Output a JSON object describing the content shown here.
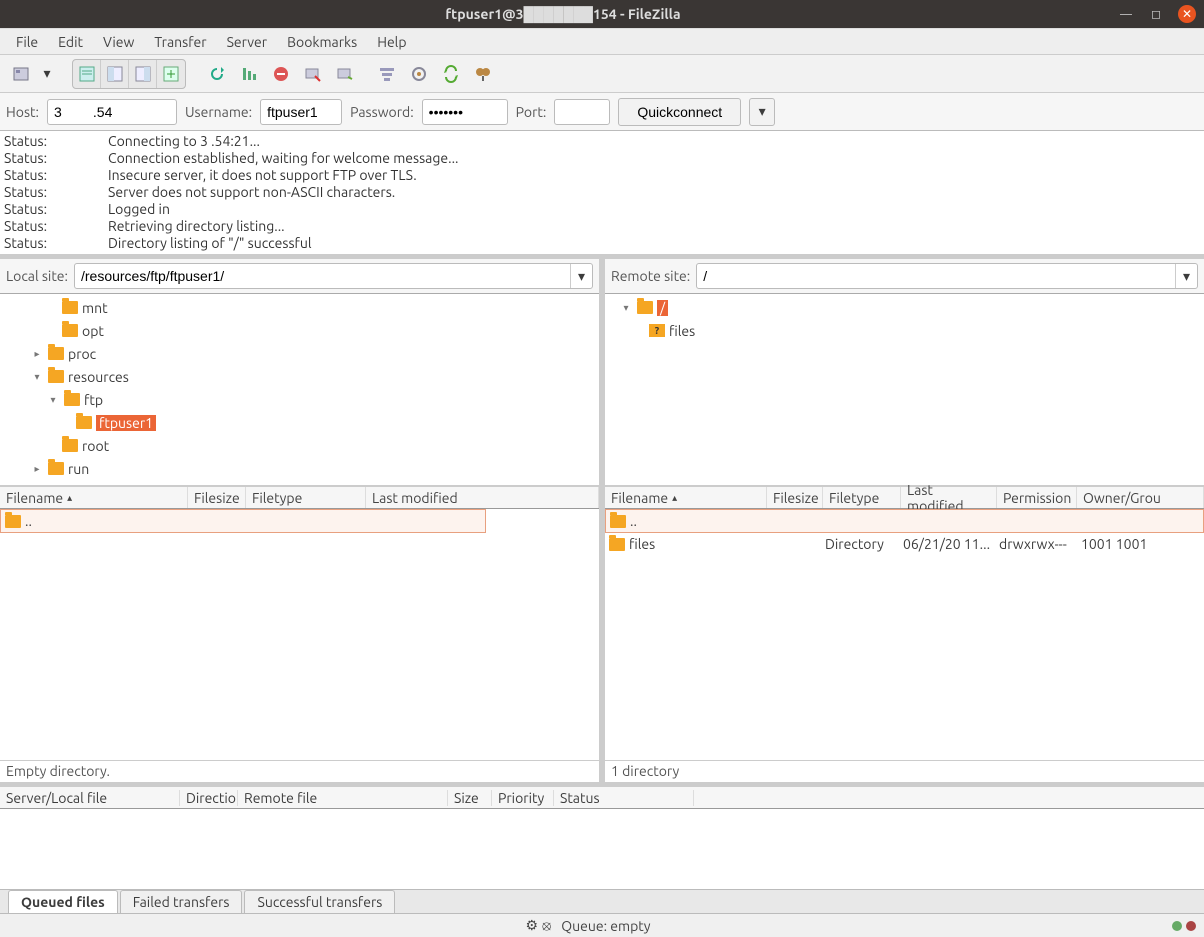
{
  "titlebar": {
    "title": "ftpuser1@3███████154 - FileZilla"
  },
  "menu": {
    "items": [
      "File",
      "Edit",
      "View",
      "Transfer",
      "Server",
      "Bookmarks",
      "Help"
    ]
  },
  "quickconnect": {
    "host_label": "Host:",
    "host_value": "3        .54",
    "user_label": "Username:",
    "user_value": "ftpuser1",
    "pass_label": "Password:",
    "pass_value": "•••••••",
    "port_label": "Port:",
    "port_value": "",
    "button": "Quickconnect"
  },
  "log": {
    "rows": [
      {
        "label": "Status:",
        "msg": "Connecting to 3          .54:21..."
      },
      {
        "label": "Status:",
        "msg": "Connection established, waiting for welcome message..."
      },
      {
        "label": "Status:",
        "msg": "Insecure server, it does not support FTP over TLS."
      },
      {
        "label": "Status:",
        "msg": "Server does not support non-ASCII characters."
      },
      {
        "label": "Status:",
        "msg": "Logged in"
      },
      {
        "label": "Status:",
        "msg": "Retrieving directory listing..."
      },
      {
        "label": "Status:",
        "msg": "Directory listing of \"/\" successful"
      }
    ]
  },
  "local": {
    "label": "Local site:",
    "path": "/resources/ftp/ftpuser1/",
    "tree": [
      "mnt",
      "opt",
      "proc",
      "resources",
      "ftp",
      "ftpuser1",
      "root",
      "run"
    ],
    "columns": [
      "Filename",
      "Filesize",
      "Filetype",
      "Last modified"
    ],
    "updir": "..",
    "status": "Empty directory."
  },
  "remote": {
    "label": "Remote site:",
    "path": "/",
    "root": "/",
    "child": "files",
    "columns": [
      "Filename",
      "Filesize",
      "Filetype",
      "Last modified",
      "Permission",
      "Owner/Grou"
    ],
    "updir": "..",
    "rows": [
      {
        "name": "files",
        "size": "",
        "type": "Directory",
        "modified": "06/21/20 11...",
        "perm": "drwxrwx---",
        "owner": "1001 1001"
      }
    ],
    "status": "1 directory"
  },
  "queue": {
    "columns": [
      "Server/Local file",
      "Directio",
      "Remote file",
      "Size",
      "Priority",
      "Status"
    ]
  },
  "tabs": {
    "queued": "Queued files",
    "failed": "Failed transfers",
    "success": "Successful transfers"
  },
  "statusbar": {
    "queue": "Queue: empty"
  }
}
